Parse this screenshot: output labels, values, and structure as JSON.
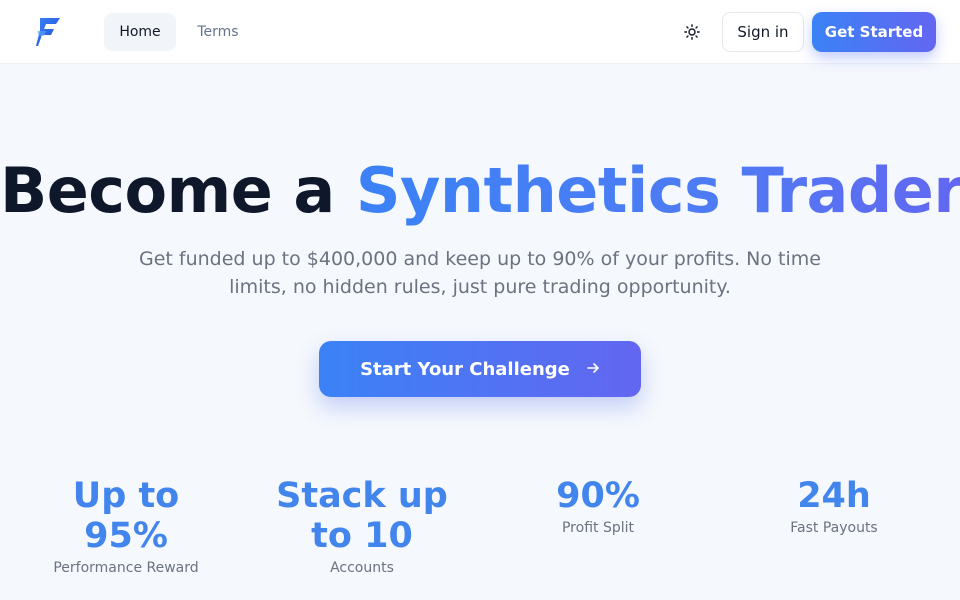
{
  "header": {
    "nav": [
      {
        "label": "Home",
        "active": true
      },
      {
        "label": "Terms",
        "active": false
      }
    ],
    "theme_icon": "sun-icon",
    "sign_in_label": "Sign in",
    "get_started_label": "Get Started"
  },
  "hero": {
    "title_prefix": "Become a ",
    "title_highlight": "Synthetics Trader",
    "subtitle": "Get funded up to $400,000 and keep up to 90% of your profits. No time limits, no hidden rules, just pure trading opportunity.",
    "cta_label": "Start Your Challenge",
    "cta_icon": "arrow-right-icon"
  },
  "stats": [
    {
      "value": "Up to 95%",
      "label": "Performance Reward"
    },
    {
      "value": "Stack up to 10",
      "label": "Accounts"
    },
    {
      "value": "90%",
      "label": "Profit Split"
    },
    {
      "value": "24h",
      "label": "Fast Payouts"
    }
  ],
  "colors": {
    "accent_start": "#3b82f6",
    "accent_end": "#6366f1",
    "stat_value": "#4285ec",
    "heading": "#0f172a",
    "muted": "#6b7280",
    "background": "#f5f8fc"
  }
}
